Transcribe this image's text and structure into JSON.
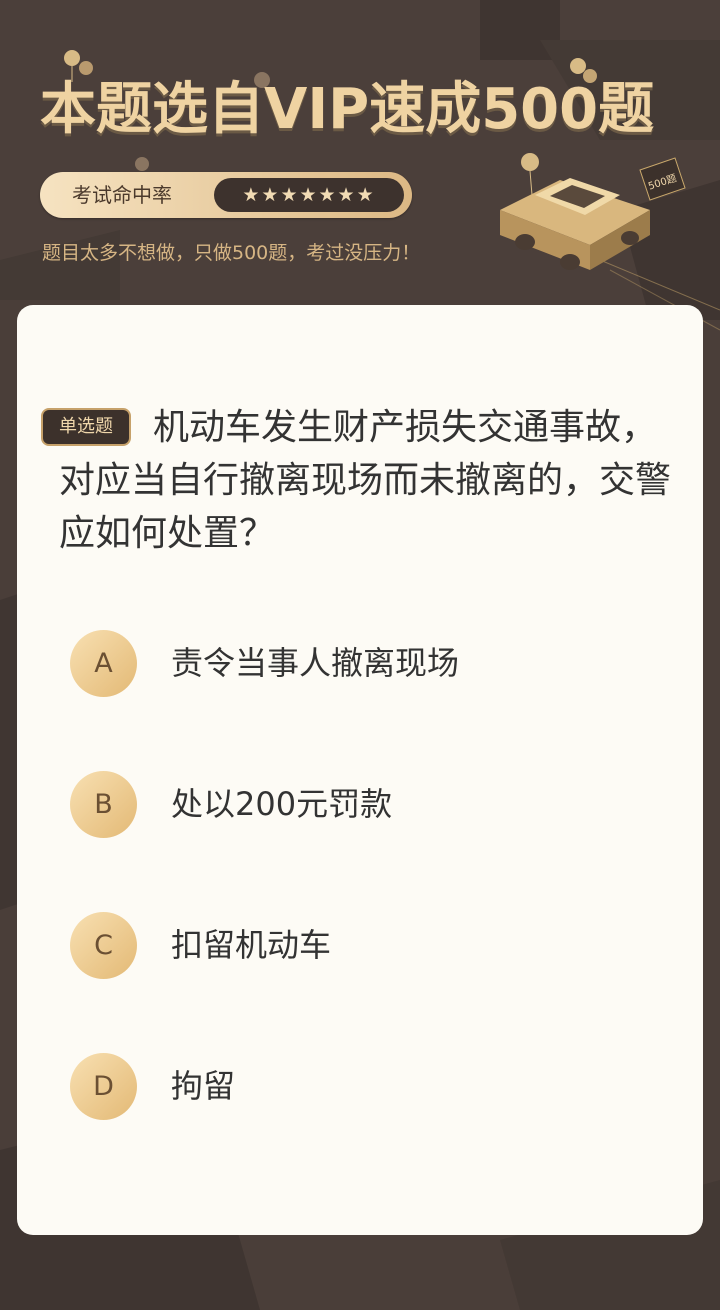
{
  "banner": {
    "title": "本题选自VIP速成500题",
    "rate_label": "考试命中率",
    "stars": "★★★★★★★",
    "tagline": "题目太多不想做，只做500题，考过没压力！",
    "car_badge": "500题"
  },
  "question": {
    "type_label": "单选题",
    "text": "机动车发生财产损失交通事故，对应当自行撤离现场而未撤离的，交警应如何处置？"
  },
  "options": [
    {
      "letter": "A",
      "text": "责令当事人撤离现场"
    },
    {
      "letter": "B",
      "text": "处以200元罚款"
    },
    {
      "letter": "C",
      "text": "扣留机动车"
    },
    {
      "letter": "D",
      "text": "拘留"
    }
  ],
  "colors": {
    "background": "#4a3e39",
    "gold": "#efd3a2",
    "card": "#fdfbf5"
  }
}
